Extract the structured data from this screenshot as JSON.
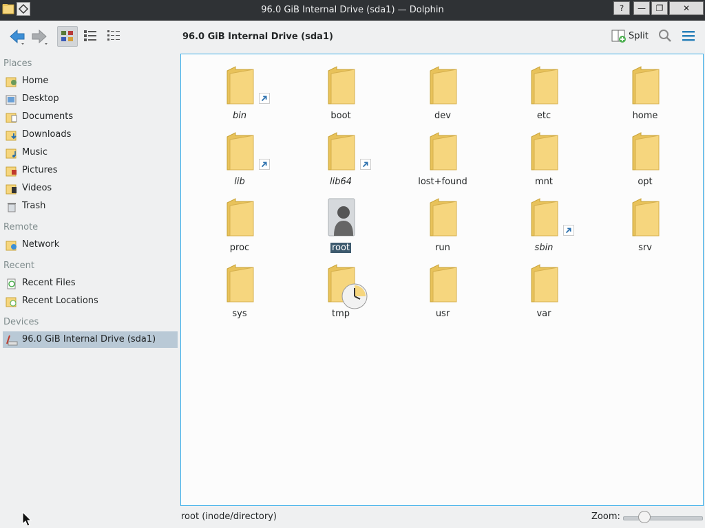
{
  "window": {
    "title": "96.0 GiB Internal Drive (sda1) — Dolphin",
    "help_label": "?",
    "minimize_label": "—",
    "maximize_label": "❐",
    "close_label": "✕"
  },
  "toolbar": {
    "breadcrumb": "96.0 GiB Internal Drive (sda1)",
    "split_label": "Split",
    "view_modes": [
      "icons",
      "compact",
      "details"
    ],
    "active_view_mode": "icons"
  },
  "sidebar": {
    "places_header": "Places",
    "places": [
      {
        "label": "Home",
        "icon": "home-folder-icon"
      },
      {
        "label": "Desktop",
        "icon": "desktop-icon"
      },
      {
        "label": "Documents",
        "icon": "documents-folder-icon"
      },
      {
        "label": "Downloads",
        "icon": "downloads-folder-icon"
      },
      {
        "label": "Music",
        "icon": "music-folder-icon"
      },
      {
        "label": "Pictures",
        "icon": "pictures-folder-icon"
      },
      {
        "label": "Videos",
        "icon": "videos-folder-icon"
      },
      {
        "label": "Trash",
        "icon": "trash-icon"
      }
    ],
    "remote_header": "Remote",
    "remote": [
      {
        "label": "Network",
        "icon": "network-folder-icon"
      }
    ],
    "recent_header": "Recent",
    "recent": [
      {
        "label": "Recent Files",
        "icon": "recent-files-icon"
      },
      {
        "label": "Recent Locations",
        "icon": "recent-locations-icon"
      }
    ],
    "devices_header": "Devices",
    "devices": [
      {
        "label": "96.0 GiB Internal Drive (sda1)",
        "icon": "hard-drive-icon",
        "selected": true
      }
    ]
  },
  "files": [
    {
      "name": "bin",
      "symlink": true,
      "kind": "folder"
    },
    {
      "name": "boot",
      "symlink": false,
      "kind": "folder"
    },
    {
      "name": "dev",
      "symlink": false,
      "kind": "folder"
    },
    {
      "name": "etc",
      "symlink": false,
      "kind": "folder"
    },
    {
      "name": "home",
      "symlink": false,
      "kind": "folder"
    },
    {
      "name": "lib",
      "symlink": true,
      "kind": "folder"
    },
    {
      "name": "lib64",
      "symlink": true,
      "kind": "folder"
    },
    {
      "name": "lost+found",
      "symlink": false,
      "kind": "folder"
    },
    {
      "name": "mnt",
      "symlink": false,
      "kind": "folder"
    },
    {
      "name": "opt",
      "symlink": false,
      "kind": "folder"
    },
    {
      "name": "proc",
      "symlink": false,
      "kind": "folder"
    },
    {
      "name": "root",
      "symlink": false,
      "kind": "user-folder",
      "selected": true
    },
    {
      "name": "run",
      "symlink": false,
      "kind": "folder"
    },
    {
      "name": "sbin",
      "symlink": true,
      "kind": "folder"
    },
    {
      "name": "srv",
      "symlink": false,
      "kind": "folder"
    },
    {
      "name": "sys",
      "symlink": false,
      "kind": "folder"
    },
    {
      "name": "tmp",
      "symlink": false,
      "kind": "temp-folder"
    },
    {
      "name": "usr",
      "symlink": false,
      "kind": "folder"
    },
    {
      "name": "var",
      "symlink": false,
      "kind": "folder"
    }
  ],
  "status": {
    "text": "root (inode/directory)",
    "zoom_label": "Zoom:",
    "zoom_level": 0.28
  },
  "colors": {
    "accent": "#3daee9",
    "selection": "#3d5a6e",
    "folder": "#f6d67e",
    "titlebar": "#2f3235"
  }
}
